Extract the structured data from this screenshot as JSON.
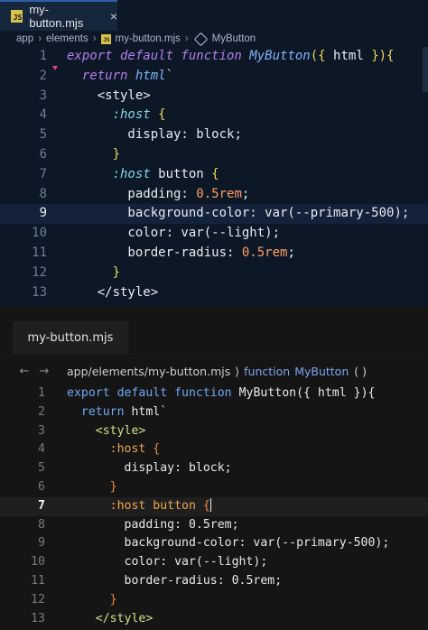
{
  "top_editor": {
    "tab": {
      "icon": "js-file-icon",
      "label": "my-button.mjs",
      "close": "×"
    },
    "breadcrumb": [
      "app",
      "elements",
      "my-button.mjs",
      "MyButton"
    ],
    "lines": [
      {
        "n": "1",
        "tokens": [
          [
            "k",
            "export default function "
          ],
          [
            "f",
            "MyButton"
          ],
          [
            "p",
            "({ "
          ],
          [
            "t",
            "html "
          ],
          [
            "p",
            "}){"
          ]
        ]
      },
      {
        "n": "2",
        "tokens": [
          [
            "t",
            "  "
          ],
          [
            "k",
            "return "
          ],
          [
            "f",
            "html"
          ],
          [
            "s",
            "`"
          ]
        ]
      },
      {
        "n": "3",
        "tokens": [
          [
            "t",
            "    <style>"
          ]
        ]
      },
      {
        "n": "4",
        "tokens": [
          [
            "t",
            "      "
          ],
          [
            "sel",
            ":host "
          ],
          [
            "p",
            "{"
          ]
        ]
      },
      {
        "n": "5",
        "tokens": [
          [
            "t",
            "        display: "
          ],
          [
            "t",
            "block;"
          ]
        ]
      },
      {
        "n": "6",
        "tokens": [
          [
            "t",
            "      "
          ],
          [
            "p",
            "}"
          ]
        ]
      },
      {
        "n": "7",
        "tokens": [
          [
            "t",
            "      "
          ],
          [
            "sel",
            ":host "
          ],
          [
            "t",
            "button "
          ],
          [
            "p",
            "{"
          ]
        ]
      },
      {
        "n": "8",
        "tokens": [
          [
            "t",
            "        padding: "
          ],
          [
            "num",
            "0.5rem"
          ],
          [
            "t",
            ";"
          ]
        ]
      },
      {
        "n": "9",
        "tokens": [
          [
            "t",
            "        background-color: var("
          ],
          [
            "t",
            "--primary-500"
          ],
          [
            "t",
            ");"
          ]
        ]
      },
      {
        "n": "10",
        "tokens": [
          [
            "t",
            "        color: var("
          ],
          [
            "t",
            "--light"
          ],
          [
            "t",
            ");"
          ]
        ]
      },
      {
        "n": "11",
        "tokens": [
          [
            "t",
            "        border-radius: "
          ],
          [
            "num",
            "0.5rem"
          ],
          [
            "t",
            ";"
          ]
        ]
      },
      {
        "n": "12",
        "tokens": [
          [
            "t",
            "      "
          ],
          [
            "p",
            "}"
          ]
        ]
      },
      {
        "n": "13",
        "tokens": [
          [
            "t",
            "    </style>"
          ]
        ]
      }
    ],
    "active_line": "9"
  },
  "bottom_editor": {
    "tab": {
      "label": "my-button.mjs"
    },
    "nav": {
      "back": "←",
      "forward": "→"
    },
    "breadcrumb": {
      "path": "app/elements/my-button.mjs",
      "sep": "⟩",
      "fn_keyword": "function",
      "fn_name": "MyButton",
      "parens": "( )"
    },
    "lines": [
      {
        "n": "1",
        "tokens": [
          [
            "k",
            "export default function "
          ],
          [
            "f",
            "MyButton"
          ],
          [
            "t",
            "({ "
          ],
          [
            "t",
            "html "
          ],
          [
            "t",
            "}){"
          ]
        ]
      },
      {
        "n": "2",
        "tokens": [
          [
            "t",
            "  "
          ],
          [
            "k",
            "return "
          ],
          [
            "f",
            "html"
          ],
          [
            "s",
            "`"
          ]
        ]
      },
      {
        "n": "3",
        "tokens": [
          [
            "t",
            "    "
          ],
          [
            "s",
            "<style>"
          ]
        ]
      },
      {
        "n": "4",
        "tokens": [
          [
            "t",
            "      "
          ],
          [
            "sel",
            ":host "
          ],
          [
            "br",
            "{"
          ]
        ]
      },
      {
        "n": "5",
        "tokens": [
          [
            "t",
            "        display: block;"
          ]
        ]
      },
      {
        "n": "6",
        "tokens": [
          [
            "t",
            "      "
          ],
          [
            "br",
            "}"
          ]
        ]
      },
      {
        "n": "7",
        "tokens": [
          [
            "t",
            "      "
          ],
          [
            "sel",
            ":host button "
          ],
          [
            "br",
            "{"
          ]
        ]
      },
      {
        "n": "8",
        "tokens": [
          [
            "t",
            "        padding: 0.5rem;"
          ]
        ]
      },
      {
        "n": "9",
        "tokens": [
          [
            "t",
            "        background-color: var(--primary-500);"
          ]
        ]
      },
      {
        "n": "10",
        "tokens": [
          [
            "t",
            "        color: var(--light);"
          ]
        ]
      },
      {
        "n": "11",
        "tokens": [
          [
            "t",
            "        border-radius: 0.5rem;"
          ]
        ]
      },
      {
        "n": "12",
        "tokens": [
          [
            "t",
            "      "
          ],
          [
            "br",
            "}"
          ]
        ]
      },
      {
        "n": "13",
        "tokens": [
          [
            "t",
            "    "
          ],
          [
            "s",
            "</style>"
          ]
        ]
      }
    ],
    "active_line": "7"
  }
}
